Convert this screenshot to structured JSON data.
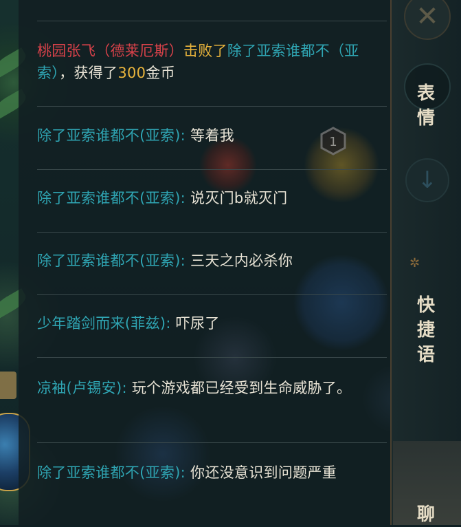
{
  "chat": {
    "messages": [
      {
        "parts": [
          {
            "text": "桃园张飞（德莱厄斯）",
            "color": "red"
          },
          {
            "text": "击败了",
            "color": "gold"
          },
          {
            "text": "除了亚索谁都不（亚索）",
            "color": "teal"
          },
          {
            "text": "，获得了",
            "color": "white"
          },
          {
            "text": "300",
            "color": "gold"
          },
          {
            "text": "金币",
            "color": "white"
          }
        ]
      },
      {
        "parts": [
          {
            "text": "除了亚索谁都不(亚索):",
            "color": "teal"
          },
          {
            "text": " 等着我",
            "color": "white"
          }
        ]
      },
      {
        "parts": [
          {
            "text": "除了亚索谁都不(亚索):",
            "color": "teal"
          },
          {
            "text": " 说灭门b就灭门",
            "color": "white"
          }
        ]
      },
      {
        "parts": [
          {
            "text": "除了亚索谁都不(亚索):",
            "color": "teal"
          },
          {
            "text": " 三天之内必杀你",
            "color": "white"
          }
        ]
      },
      {
        "parts": [
          {
            "text": "少年踏剑而来(菲兹):",
            "color": "teal"
          },
          {
            "text": " 吓尿了",
            "color": "white"
          }
        ]
      },
      {
        "parts": [
          {
            "text": "凉袖(卢锡安):",
            "color": "teal"
          },
          {
            "text": " 玩个游戏都已经受到生命威胁了。",
            "color": "white"
          }
        ]
      },
      {
        "parts": [
          {
            "text": "除了亚索谁都不(亚索):",
            "color": "teal"
          },
          {
            "text": " 你还没意识到问题严重",
            "color": "white"
          }
        ]
      }
    ]
  },
  "sidebar": {
    "close_icon": "close-icon",
    "scroll_icon": "arrow-down-icon",
    "tabs": [
      {
        "label": "表\n情"
      },
      {
        "label": "快\n捷\n语"
      },
      {
        "label": "聊"
      }
    ]
  },
  "background": {
    "badge_number": "1"
  },
  "colors": {
    "red": "#d9424a",
    "gold": "#e9b43c",
    "teal": "#2fa5b3",
    "white": "#e7e2d4"
  }
}
